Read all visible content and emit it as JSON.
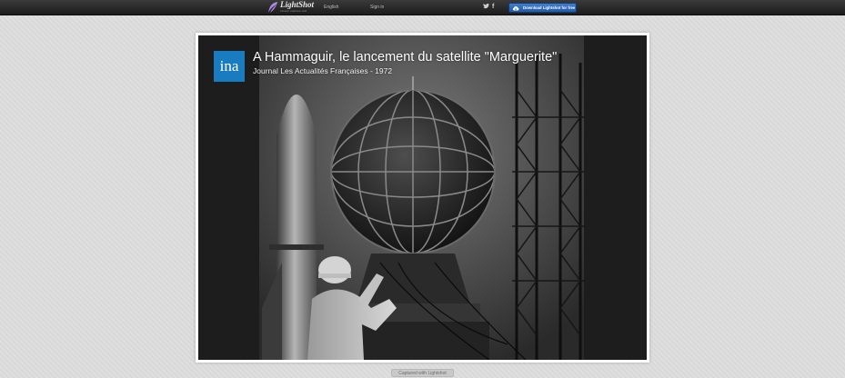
{
  "topbar": {
    "logo_name": "LightShot",
    "logo_tagline": "screen capture tool",
    "language": "English",
    "login": "Sign in",
    "twitter_icon": "twitter-icon",
    "facebook_icon": "facebook-icon",
    "download_label": "Download Lightshot for free"
  },
  "screenshot": {
    "channel_logo": "ina",
    "title": "A Hammaguir, le lancement du satellite \"Marguerite\"",
    "subtitle": "Journal Les Actualités Françaises - 1972"
  },
  "footer": {
    "label": "Captured with Lightshot"
  },
  "colors": {
    "topbar": "#222222",
    "download_button": "#2e6bbd",
    "ina_blue": "#1a7cc0",
    "page_background": "#dcdcdc"
  }
}
